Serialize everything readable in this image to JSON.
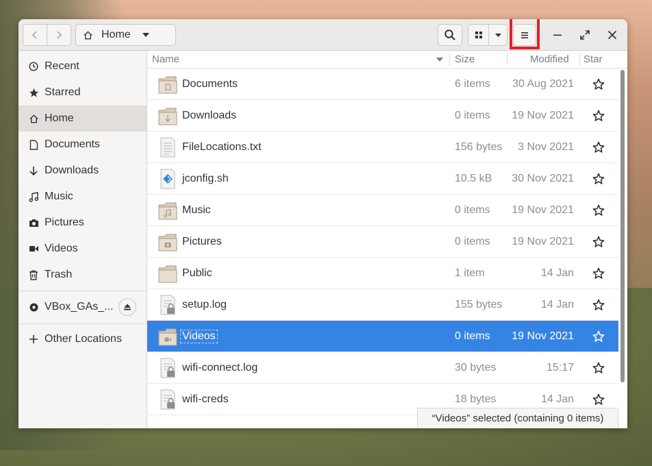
{
  "header": {
    "path_label": "Home",
    "icons": [
      "chevron-left-icon",
      "chevron-right-icon",
      "home-icon",
      "caret-down-icon",
      "search-icon",
      "grid-view-icon",
      "caret-down-icon",
      "hamburger-menu-icon",
      "minimize-icon",
      "maximize-icon",
      "close-icon"
    ]
  },
  "sidebar": {
    "items": [
      {
        "label": "Recent",
        "icon": "clock-icon"
      },
      {
        "label": "Starred",
        "icon": "star-icon"
      },
      {
        "label": "Home",
        "icon": "home-icon",
        "active": true
      },
      {
        "label": "Documents",
        "icon": "document-icon"
      },
      {
        "label": "Downloads",
        "icon": "download-icon"
      },
      {
        "label": "Music",
        "icon": "music-icon"
      },
      {
        "label": "Pictures",
        "icon": "camera-icon"
      },
      {
        "label": "Videos",
        "icon": "video-icon"
      },
      {
        "label": "Trash",
        "icon": "trash-icon"
      }
    ],
    "device": {
      "label": "VBox_GAs_...",
      "icon": "disc-icon"
    },
    "other": {
      "label": "Other Locations",
      "icon": "plus-icon"
    }
  },
  "columns": {
    "name": "Name",
    "size": "Size",
    "modified": "Modified",
    "star": "Star"
  },
  "files": [
    {
      "name": "Documents",
      "size": "6 items",
      "modified": "30 Aug 2021",
      "type": "folder-documents"
    },
    {
      "name": "Downloads",
      "size": "0 items",
      "modified": "19 Nov 2021",
      "type": "folder-downloads"
    },
    {
      "name": "FileLocations.txt",
      "size": "156 bytes",
      "modified": "3 Nov 2021",
      "type": "text"
    },
    {
      "name": "jconfig.sh",
      "size": "10.5 kB",
      "modified": "30 Nov 2021",
      "type": "script"
    },
    {
      "name": "Music",
      "size": "0 items",
      "modified": "19 Nov 2021",
      "type": "folder-music"
    },
    {
      "name": "Pictures",
      "size": "0 items",
      "modified": "19 Nov 2021",
      "type": "folder-pictures"
    },
    {
      "name": "Public",
      "size": "1 item",
      "modified": "14 Jan",
      "type": "folder"
    },
    {
      "name": "setup.log",
      "size": "155 bytes",
      "modified": "14 Jan",
      "type": "locked-text"
    },
    {
      "name": "Videos",
      "size": "0 items",
      "modified": "19 Nov 2021",
      "type": "folder-videos",
      "selected": true
    },
    {
      "name": "wifi-connect.log",
      "size": "30 bytes",
      "modified": "15:17",
      "type": "locked-text"
    },
    {
      "name": "wifi-creds",
      "size": "18 bytes",
      "modified": "14 Jan",
      "type": "locked-text"
    }
  ],
  "status_toast": "“Videos” selected (containing 0 items)",
  "colors": {
    "selection": "#3584e4",
    "highlight_box": "#e21f26",
    "headerbar": "#ebeae8"
  }
}
